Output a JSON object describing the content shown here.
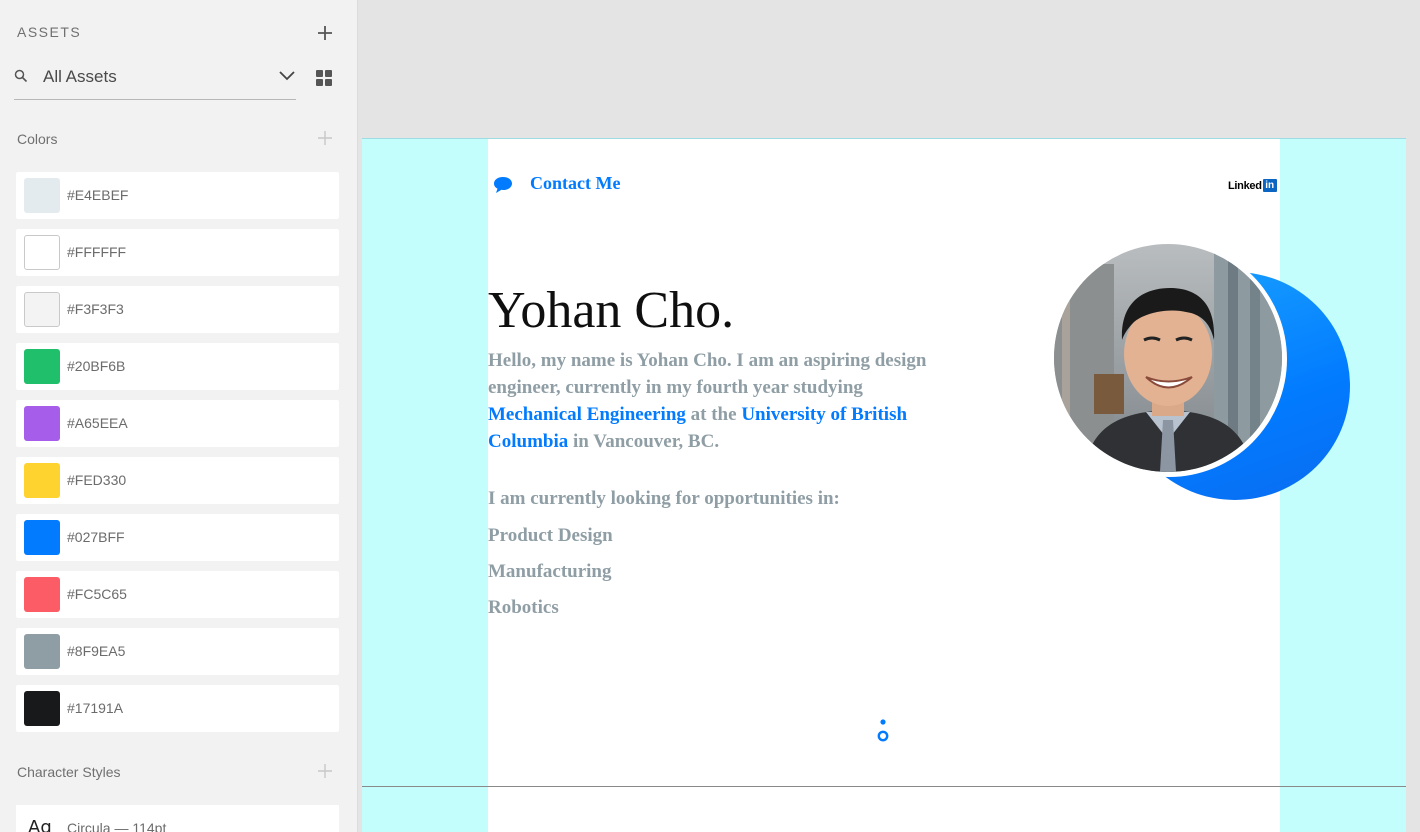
{
  "assets_panel": {
    "title": "ASSETS",
    "filter": {
      "selected": "All Assets"
    },
    "colors_heading": "Colors",
    "colors": [
      {
        "hex": "#E4EBEF",
        "swatch": "#E4EBEF"
      },
      {
        "hex": "#FFFFFF",
        "swatch": "#FFFFFF"
      },
      {
        "hex": "#F3F3F3",
        "swatch": "#F3F3F3"
      },
      {
        "hex": "#20BF6B",
        "swatch": "#20BF6B"
      },
      {
        "hex": "#A65EEA",
        "swatch": "#A65EEA"
      },
      {
        "hex": "#FED330",
        "swatch": "#FED330"
      },
      {
        "hex": "#027BFF",
        "swatch": "#027BFF"
      },
      {
        "hex": "#FC5C65",
        "swatch": "#FC5C65"
      },
      {
        "hex": "#8F9EA5",
        "swatch": "#8F9EA5"
      },
      {
        "hex": "#17191A",
        "swatch": "#17191A"
      }
    ],
    "character_styles_heading": "Character Styles",
    "character_style": {
      "glyph": "Ag",
      "label": "Circula — 114pt"
    }
  },
  "artboard": {
    "contact_label": "Contact Me",
    "linkedin": {
      "word": "Linked",
      "box": "in"
    },
    "name": "Yohan Cho.",
    "intro": {
      "part1": "Hello, my name is Yohan Cho. I am an aspiring design engineer, currently in my fourth year studying ",
      "major": "Mechanical Engineering",
      "part2": " at the ",
      "university": "University of British Columbia",
      "part3": " in Vancouver, BC."
    },
    "looking_for": "I am currently looking for opportunities in:",
    "opportunities": [
      "Product Design",
      "Manufacturing",
      "Robotics"
    ]
  },
  "theme": {
    "accent": "#027BFF",
    "guide": "#C3FDFC",
    "muted_text": "#8F9EA5"
  }
}
